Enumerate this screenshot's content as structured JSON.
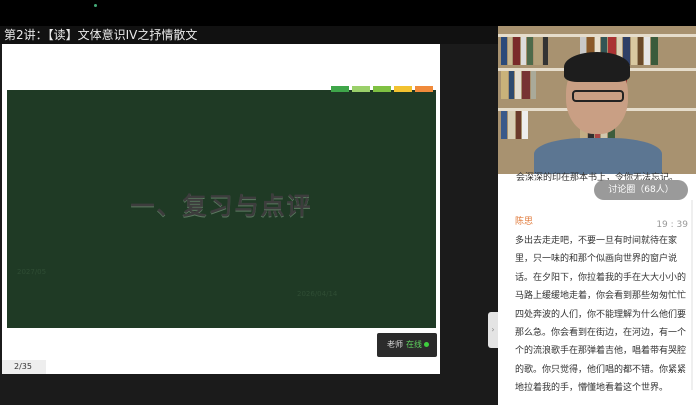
{
  "header": {
    "lesson_title": "第2讲：【读】文体意识IV之抒情散文"
  },
  "slide": {
    "heading": "一、复习与点评",
    "faint_left": "2027/05",
    "faint_bottom": "2026/04/14",
    "stripe_colors": [
      "#3fa64a",
      "#9ad06a",
      "#7fc142",
      "#f2c230",
      "#f08a3b"
    ]
  },
  "player": {
    "page_indicator": "2/35",
    "teacher_label": "老师",
    "online_label": "在线"
  },
  "chat": {
    "top_text": "会深深的印在那本书上，令你无法忘记。",
    "discussion_chip": "讨论圈（68人）",
    "messages": [
      {
        "name": "陈思",
        "time": "19 : 39",
        "text": "多出去走走吧，不要一旦有时间就待在家里，只一味的和那个似画向世界的窗户说话。在夕阳下，你拉着我的手在大大小小的马路上缓缓地走着，你会看到那些匆匆忙忙四处奔波的人们，你不能理解为什么他们要那么急。你会看到在街边，在河边，有一个个的流浪歌手在那弹着吉他，唱着带有哭腔的歌。你只觉得，他们唱的都不错。你紧紧地拉着我的手，懵懂地看着这个世界。"
      }
    ]
  },
  "icons": {
    "collapse": "chevron-right-icon"
  }
}
